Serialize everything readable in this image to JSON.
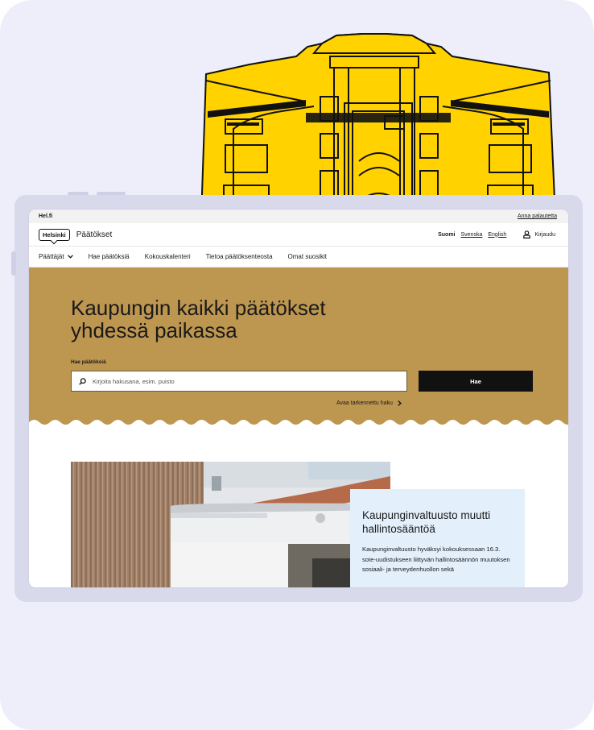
{
  "colors": {
    "page_background": "#eeeefb",
    "tablet_frame": "#d9d9ec",
    "illustration_fill": "#ffd200",
    "hero_background": "#bd9650",
    "search_button": "#111111",
    "news_card": "#e3effb"
  },
  "illustration": {
    "icon": "helsinki-building-illustration"
  },
  "topbar": {
    "site_link": "Hel.fi",
    "feedback_link": "Anna palautetta"
  },
  "header": {
    "logo_text": "Helsinki",
    "site_name": "Päätökset",
    "languages": {
      "fi": "Suomi",
      "sv": "Svenska",
      "en": "English"
    },
    "login_icon": "user-icon",
    "login_label": "Kirjaudu"
  },
  "nav": {
    "items": [
      {
        "label": "Päättäjät",
        "has_dropdown": true
      },
      {
        "label": "Hae päätöksiä"
      },
      {
        "label": "Kokouskalenteri"
      },
      {
        "label": "Tietoa päätöksenteosta"
      },
      {
        "label": "Omat suosikit"
      }
    ]
  },
  "hero": {
    "title_line1": "Kaupungin kaikki päätökset",
    "title_line2": "yhdessä paikassa",
    "search_label": "Hae päätöksiä",
    "search_placeholder": "Kirjoita hakusana, esim. puisto",
    "search_button": "Hae",
    "advanced_search": "Avaa tarkennettu haku"
  },
  "news": {
    "title": "Kaupunginvaltuusto muutti hallintosääntöä",
    "text": "Kaupunginvaltuusto hyväksyi kokouksessaan 16.3. sote-uudistukseen liittyvän hallintosäännön muutoksen sosiaali- ja terveydenhuollon sekä"
  }
}
